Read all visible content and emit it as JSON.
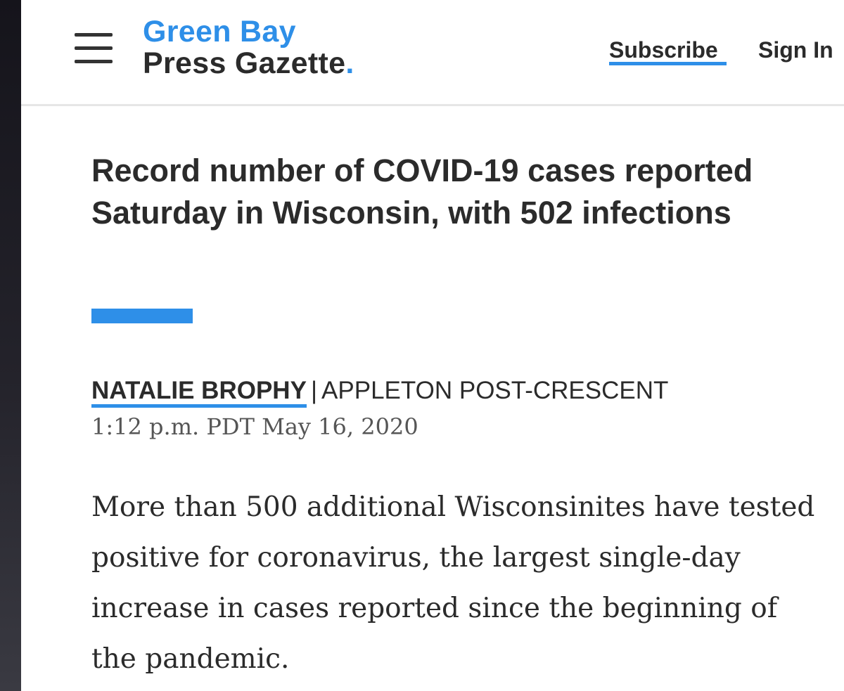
{
  "header": {
    "logo": {
      "line1": "Green Bay",
      "line2": "Press Gazette",
      "dot": "."
    },
    "menu_icon": "hamburger-menu-icon",
    "subscribe_label": "Subscribe",
    "signin_label": "Sign In"
  },
  "article": {
    "headline": "Record number of COVID-19 cases reported Saturday in Wisconsin, with 502 infections",
    "author": "NATALIE BROPHY",
    "separator": "|",
    "source": "APPLETON POST-CRESCENT",
    "timestamp": "1:12 p.m. PDT May 16, 2020",
    "lead_paragraph": "More than 500 additional Wisconsinites have tested positive for coronavirus, the largest single-day increase in cases reported since the beginning of the pandemic."
  },
  "colors": {
    "accent_blue": "#2e8fe8",
    "text_dark": "#2b2b2b",
    "text_muted": "#555555"
  }
}
